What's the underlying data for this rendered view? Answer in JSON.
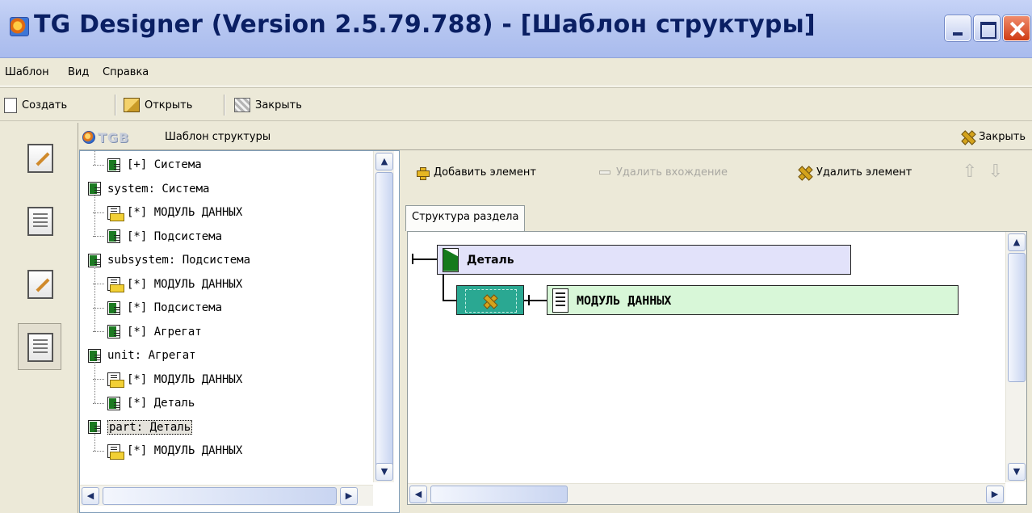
{
  "window": {
    "title": "TG Designer (Version 2.5.79.788) - [Шаблон структуры]"
  },
  "menu": [
    "Шаблон",
    "Вид",
    "Справка"
  ],
  "toolbar": {
    "create": "Создать",
    "open": "Открыть",
    "close": "Закрыть"
  },
  "header": {
    "logo_text": "TGB",
    "title": "Шаблон структуры",
    "close": "Закрыть"
  },
  "tree": [
    {
      "text": "[+] Система",
      "icon": "green-doc-icon",
      "depth": 1,
      "selected": false
    },
    {
      "text": "system: Система",
      "icon": "green-doc-icon",
      "depth": 0,
      "selected": false
    },
    {
      "text": "[*] МОДУЛЬ ДАННЫХ",
      "icon": "yellow-doc-icon",
      "depth": 1,
      "selected": false
    },
    {
      "text": "[*] Подсистема",
      "icon": "green-doc-icon",
      "depth": 1,
      "selected": false
    },
    {
      "text": "subsystem: Подсистема",
      "icon": "green-doc-icon",
      "depth": 0,
      "selected": false
    },
    {
      "text": "[*] МОДУЛЬ ДАННЫХ",
      "icon": "yellow-doc-icon",
      "depth": 1,
      "selected": false
    },
    {
      "text": "[*] Подсистема",
      "icon": "green-doc-icon",
      "depth": 1,
      "selected": false
    },
    {
      "text": "[*] Агрегат",
      "icon": "green-doc-icon",
      "depth": 1,
      "selected": false
    },
    {
      "text": "unit: Агрегат",
      "icon": "green-doc-icon",
      "depth": 0,
      "selected": false
    },
    {
      "text": "[*] МОДУЛЬ ДАННЫХ",
      "icon": "yellow-doc-icon",
      "depth": 1,
      "selected": false
    },
    {
      "text": "[*] Деталь",
      "icon": "green-doc-icon",
      "depth": 1,
      "selected": false
    },
    {
      "text": "part: Деталь",
      "icon": "green-doc-icon",
      "depth": 0,
      "selected": true
    },
    {
      "text": "[*] МОДУЛЬ ДАННЫХ",
      "icon": "yellow-doc-icon",
      "depth": 1,
      "selected": false
    }
  ],
  "actions": {
    "add": "Добавить элемент",
    "remove_occurrence": "Удалить вхождение",
    "remove_element": "Удалить элемент"
  },
  "tab": "Структура раздела",
  "diagram": {
    "root": "Деталь",
    "child": "МОДУЛЬ ДАННЫХ"
  },
  "colors": {
    "title_bar": "#b6c6f0",
    "detail_box": "#e2e2fa",
    "module_box": "#d8f7d8",
    "choice_box": "#2aa892",
    "tree_green_icon": "#1c7a22",
    "tree_yellow_icon": "#f2d035"
  },
  "icons": {
    "app": "tg-designer-globe-icon",
    "create": "new-document-icon",
    "open": "open-folder-icon",
    "close": "close-document-icon",
    "add": "plus-icon",
    "remove_occurrence": "minus-icon",
    "remove_element": "x-icon",
    "move_up": "arrow-up-icon",
    "move_down": "arrow-down-icon"
  }
}
